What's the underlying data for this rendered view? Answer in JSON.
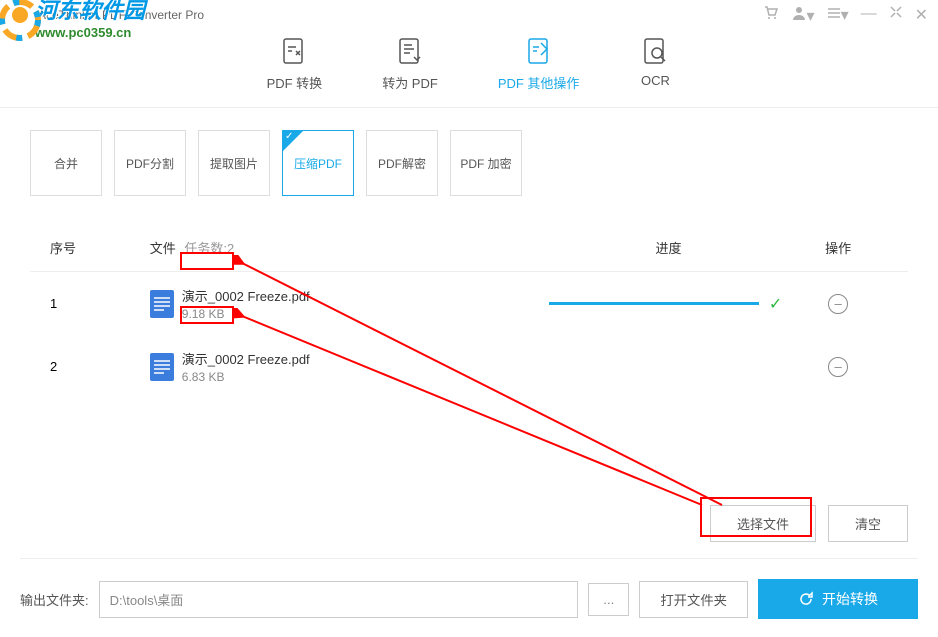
{
  "app": {
    "title": "AceThinker PDF Converter Pro"
  },
  "watermark": {
    "line1": "河东软件园",
    "line2": "www.pc0359.cn"
  },
  "main_tabs": [
    {
      "label": "PDF 转换",
      "icon": "pdf-convert"
    },
    {
      "label": "转为 PDF",
      "icon": "to-pdf"
    },
    {
      "label": "PDF 其他操作",
      "icon": "pdf-other",
      "active": true
    },
    {
      "label": "OCR",
      "icon": "ocr"
    }
  ],
  "sub_tabs": [
    {
      "label": "合并"
    },
    {
      "label": "PDF分割"
    },
    {
      "label": "提取图片"
    },
    {
      "label": "压缩PDF",
      "active": true
    },
    {
      "label": "PDF解密"
    },
    {
      "label": "PDF 加密"
    }
  ],
  "table": {
    "headers": {
      "num": "序号",
      "file": "文件",
      "task_count": "任务数:2",
      "progress": "进度",
      "action": "操作"
    },
    "rows": [
      {
        "num": "1",
        "name": "演示_0002  Freeze.pdf",
        "size": "9.18 KB",
        "done": true
      },
      {
        "num": "2",
        "name": "演示_0002  Freeze.pdf",
        "size": "6.83 KB",
        "done": false
      }
    ]
  },
  "buttons": {
    "select_file": "选择文件",
    "clear": "清空",
    "open_folder": "打开文件夹",
    "browse": "...",
    "start": "开始转换"
  },
  "footer": {
    "label": "输出文件夹:",
    "path": "D:\\tools\\桌面"
  }
}
